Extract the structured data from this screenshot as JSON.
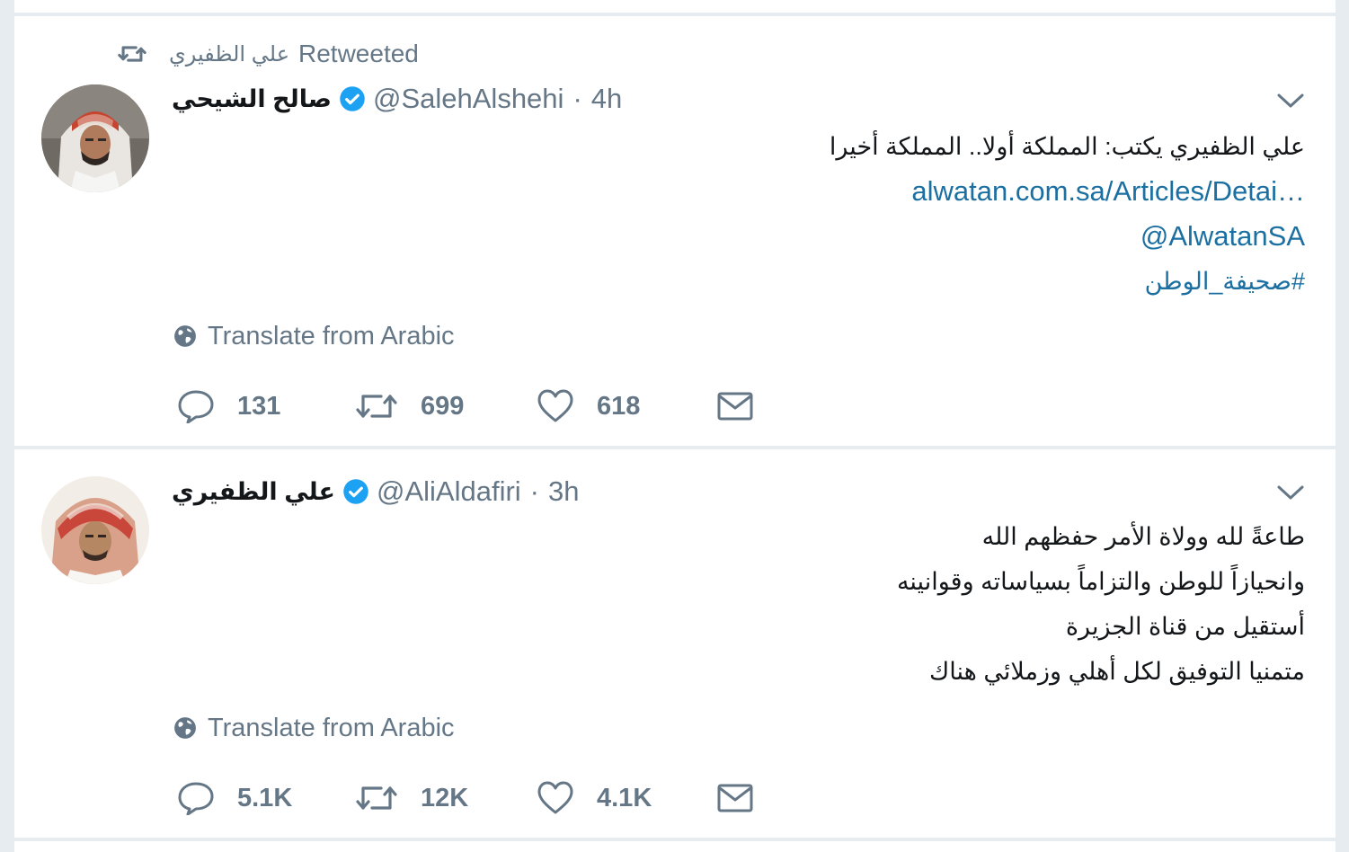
{
  "tweets": [
    {
      "retweet_context": {
        "retweeter_name": "علي الظفيري",
        "label": "Retweeted"
      },
      "author": {
        "name": "صالح الشيحي",
        "handle": "@SalehAlshehi",
        "verified": true
      },
      "time": "4h",
      "text_lines": [
        "علي الظفيري يكتب: المملكة أولا.. المملكة أخيرا"
      ],
      "link": "alwatan.com.sa/Articles/Detai…",
      "mention": "@AlwatanSA",
      "hashtag": "#صحيفة_الوطن",
      "translate_label": "Translate from Arabic",
      "stats": {
        "replies": "131",
        "retweets": "699",
        "likes": "618"
      }
    },
    {
      "author": {
        "name": "علي الظفيري",
        "handle": "@AliAldafiri",
        "verified": true
      },
      "time": "3h",
      "text_lines": [
        "طاعةً لله وولاة الأمر حفظهم الله",
        "وانحيازاً للوطن والتزاماً بسياساته وقوانينه",
        "أستقيل من قناة الجزيرة",
        "متمنيا التوفيق لكل أهلي وزملائي هناك"
      ],
      "translate_label": "Translate from Arabic",
      "stats": {
        "replies": "5.1K",
        "retweets": "12K",
        "likes": "4.1K"
      }
    }
  ],
  "icons": {
    "retweet": "retweet-icon",
    "verified": "verified-badge-icon",
    "caret": "chevron-down-icon",
    "globe": "globe-icon",
    "reply": "reply-icon",
    "like": "heart-icon",
    "dm": "envelope-icon"
  },
  "colors": {
    "link": "#1b6fa1",
    "verified": "#1da1f2",
    "muted": "#657786",
    "text": "#14171a",
    "background": "#e6ecf0"
  },
  "dot": "·"
}
